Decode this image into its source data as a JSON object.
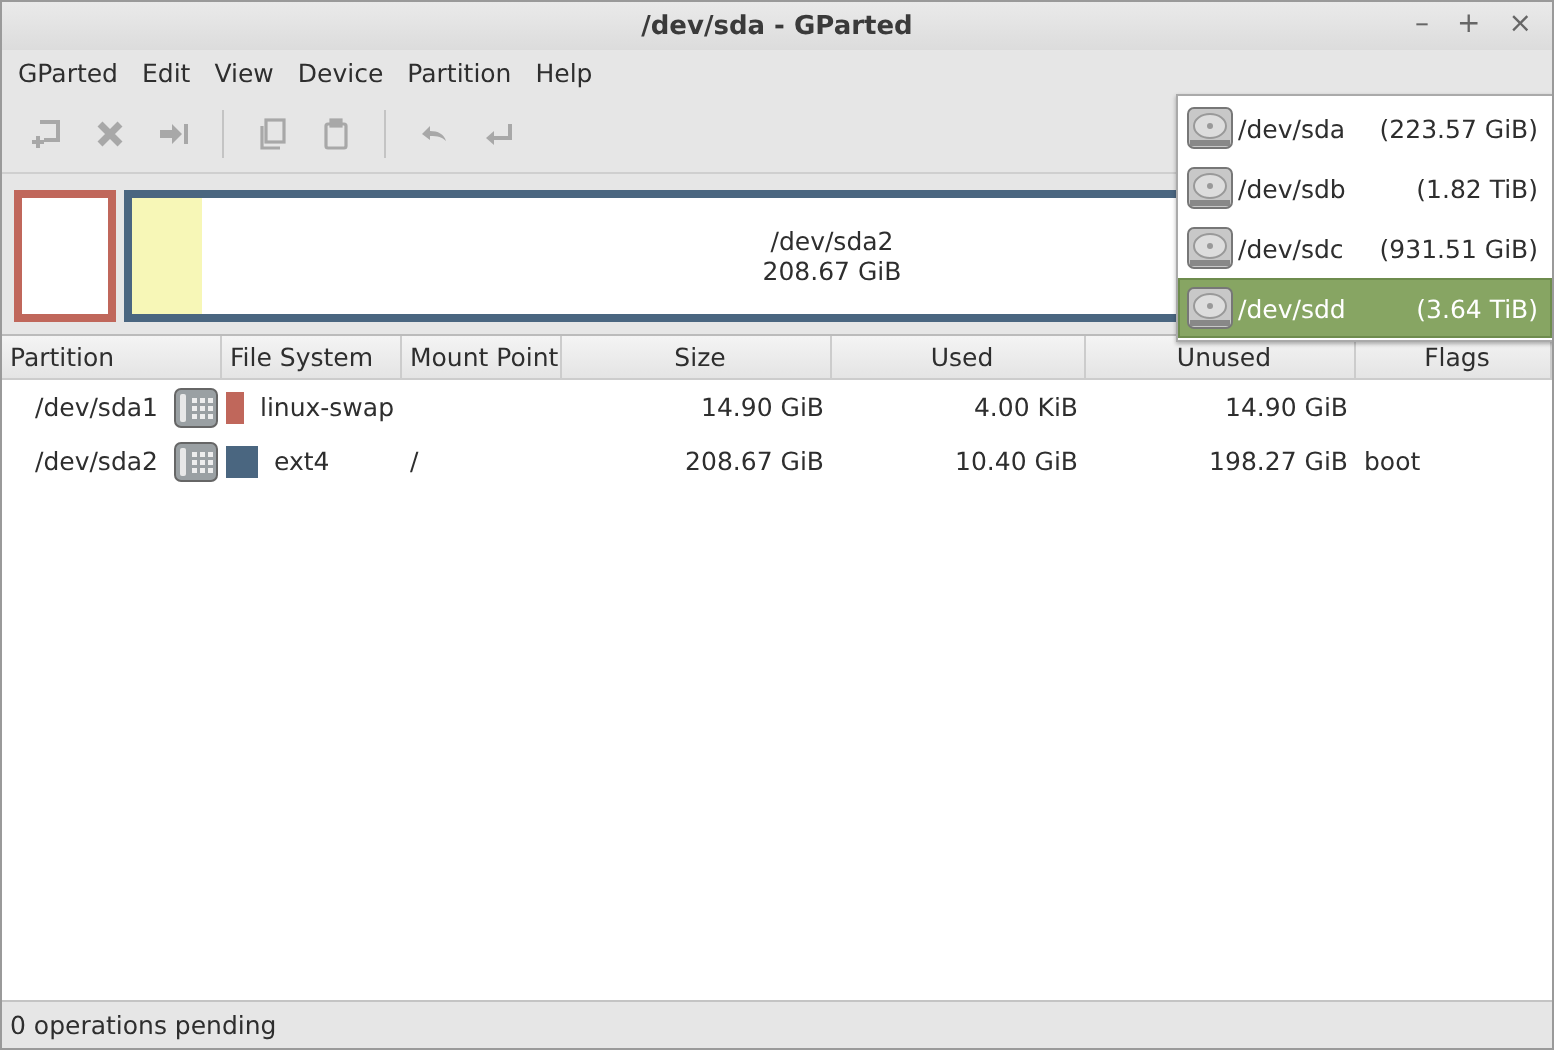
{
  "window": {
    "title": "/dev/sda - GParted",
    "controls": [
      "–",
      "+",
      "×"
    ]
  },
  "menubar": [
    "GParted",
    "Edit",
    "View",
    "Device",
    "Partition",
    "Help"
  ],
  "toolbar": [
    {
      "kind": "button",
      "disabled": true
    },
    {
      "kind": "button",
      "disabled": true
    },
    {
      "kind": "button",
      "disabled": true
    },
    {
      "kind": "sep"
    },
    {
      "kind": "button",
      "disabled": true
    },
    {
      "kind": "button",
      "disabled": true
    },
    {
      "kind": "sep"
    },
    {
      "kind": "button",
      "disabled": true
    },
    {
      "kind": "button",
      "disabled": true
    }
  ],
  "disk_map": [
    {
      "color": "#c0675b"
    },
    {
      "color": "#4a6680",
      "level": 0.05,
      "name": "/dev/sda2",
      "size": "208.67 GiB"
    }
  ],
  "table": {
    "columns": [
      "Partition",
      "File System",
      "Mount Point",
      "Size",
      "Used",
      "Unused",
      "Flags"
    ],
    "rows": [
      {
        "partition": "/dev/sda1",
        "color": "#c0675b",
        "fs": "linux-swap",
        "mount": "",
        "size": "14.90 GiB",
        "used": "4.00 KiB",
        "unused": "14.90 GiB",
        "flags": ""
      },
      {
        "partition": "/dev/sda2",
        "color": "#4a6680",
        "fs": "ext4",
        "mount": "/",
        "size": "208.67 GiB",
        "used": "10.40 GiB",
        "unused": "198.27 GiB",
        "flags": "boot"
      }
    ]
  },
  "device_menu": [
    {
      "name": "/dev/sda",
      "size": "(223.57 GiB)",
      "selected": false
    },
    {
      "name": "/dev/sdb",
      "size": "(1.82 TiB)",
      "selected": false
    },
    {
      "name": "/dev/sdc",
      "size": "(931.51 GiB)",
      "selected": false
    },
    {
      "name": "/dev/sdd",
      "size": "(3.64 TiB)",
      "selected": true
    }
  ],
  "status_bar": "0 operations pending"
}
